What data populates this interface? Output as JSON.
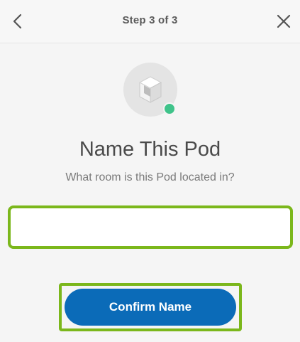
{
  "header": {
    "step_text": "Step 3 of 3",
    "back_icon": "chevron-left-icon",
    "close_icon": "close-icon"
  },
  "pod": {
    "icon": "pod-device-icon",
    "status_color": "#3fc38a"
  },
  "main": {
    "title": "Name This Pod",
    "subtitle": "What room is this Pod located in?"
  },
  "name_field": {
    "value": "",
    "placeholder": ""
  },
  "confirm": {
    "label": "Confirm Name"
  },
  "colors": {
    "accent": "#0b6bb8",
    "highlight": "#7bb71b"
  }
}
